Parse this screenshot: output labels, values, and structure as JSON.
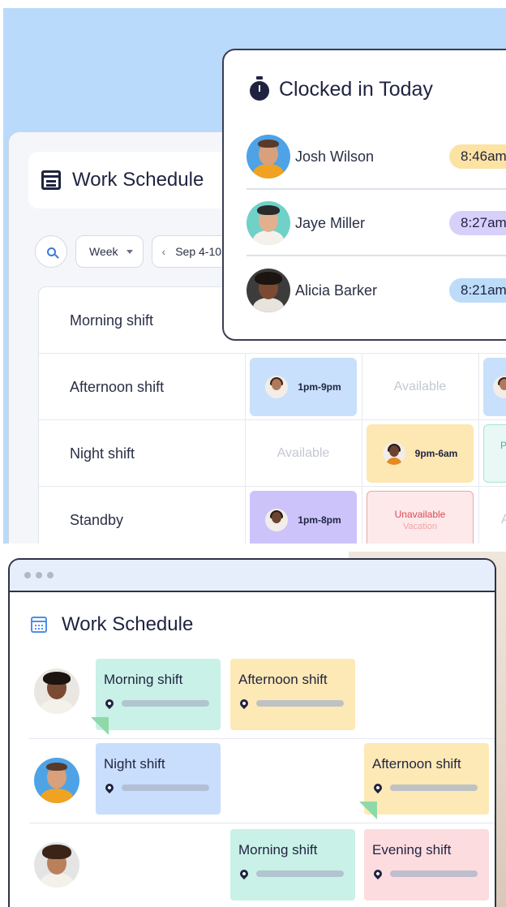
{
  "top": {
    "schedule": {
      "title": "Work Schedule",
      "view_select": "Week",
      "date_range": "Sep 4-10",
      "rows": [
        {
          "label": "Morning shift"
        },
        {
          "label": "Afternoon shift",
          "cells": [
            "1pm-9pm",
            "Available"
          ]
        },
        {
          "label": "Night shift",
          "cells": [
            "Available",
            "9pm-6am",
            "Pre"
          ]
        },
        {
          "label": "Standby",
          "cells": [
            "1pm-8pm",
            "Unavailable",
            "Vacation",
            "Av"
          ]
        }
      ]
    },
    "clocked_in": {
      "title": "Clocked in Today",
      "entries": [
        {
          "name": "Josh Wilson",
          "time": "8:46am",
          "color": "#fde3a3"
        },
        {
          "name": "Jaye Miller",
          "time": "8:27am",
          "color": "#d8d0fb"
        },
        {
          "name": "Alicia Barker",
          "time": "8:21am",
          "color": "#bcdcfa"
        }
      ]
    }
  },
  "bottom": {
    "title": "Work Schedule",
    "rows": [
      {
        "shifts": [
          "Morning shift",
          "Afternoon shift"
        ]
      },
      {
        "shifts": [
          "Night shift",
          "Afternoon shift"
        ]
      },
      {
        "shifts": [
          "Morning shift",
          "Evening shift"
        ]
      }
    ]
  }
}
